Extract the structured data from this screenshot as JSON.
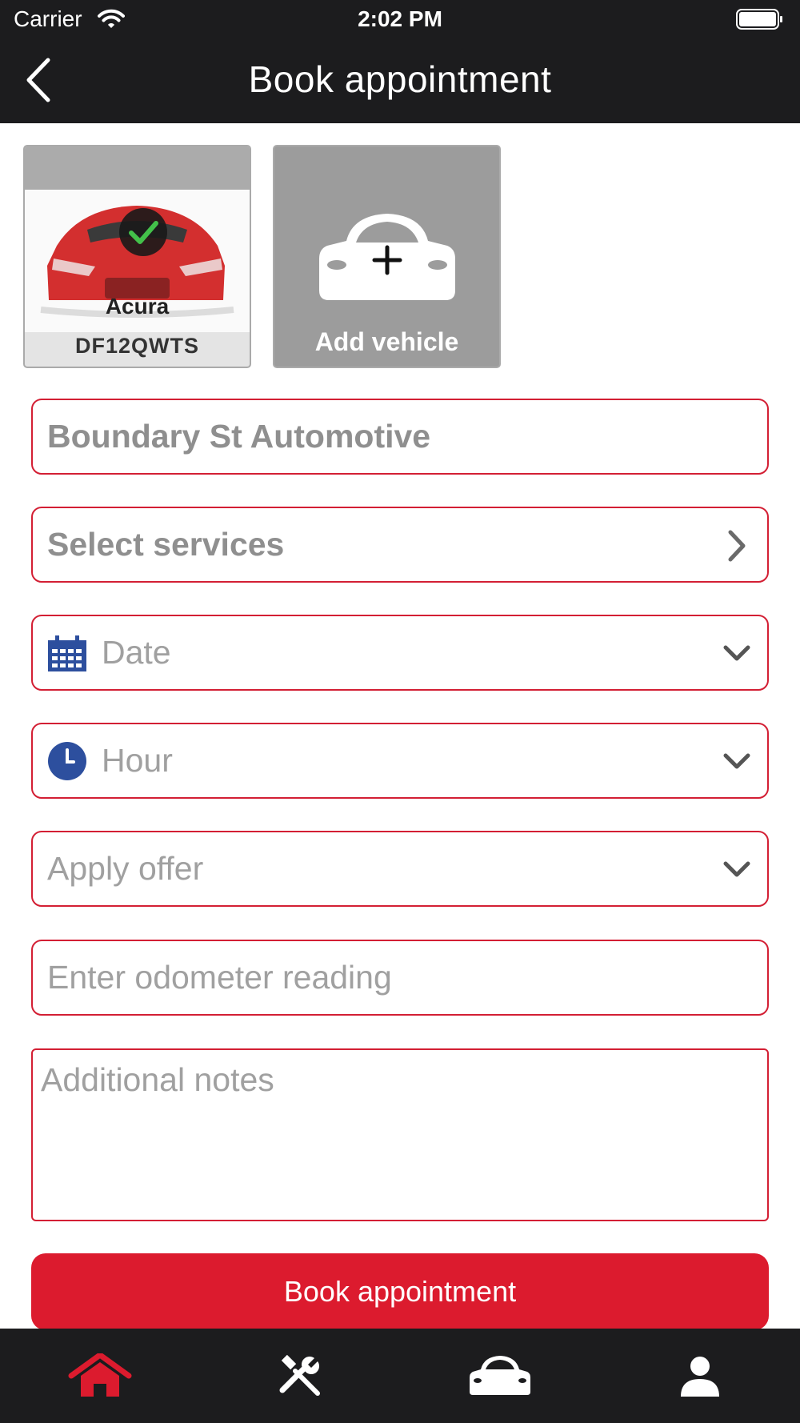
{
  "status_bar": {
    "carrier": "Carrier",
    "time": "2:02 PM"
  },
  "header": {
    "title": "Book appointment",
    "back_icon": "chevron-left-icon"
  },
  "vehicles": [
    {
      "make": "Acura",
      "plate": "DF12QWTS",
      "selected": true,
      "color": "#d32f2f"
    },
    {
      "label": "Add vehicle",
      "icon": "car-plus-icon"
    }
  ],
  "form": {
    "workshop": "Boundary St Automotive",
    "services": "Select services",
    "date_placeholder": "Date",
    "hour_placeholder": "Hour",
    "offer_placeholder": "Apply offer",
    "odometer_placeholder": "Enter odometer reading",
    "notes_placeholder": "Additional notes"
  },
  "book_button": "Book appointment",
  "tabs": [
    {
      "name": "home",
      "icon": "home-icon",
      "active": true
    },
    {
      "name": "services",
      "icon": "tools-icon",
      "active": false
    },
    {
      "name": "vehicles",
      "icon": "car-icon",
      "active": false
    },
    {
      "name": "profile",
      "icon": "user-icon",
      "active": false
    }
  ],
  "colors": {
    "accent": "#dc1b2e",
    "field_border": "#d31f34",
    "bar_bg": "#1c1c1e",
    "icon_blue": "#2d4f9e"
  }
}
